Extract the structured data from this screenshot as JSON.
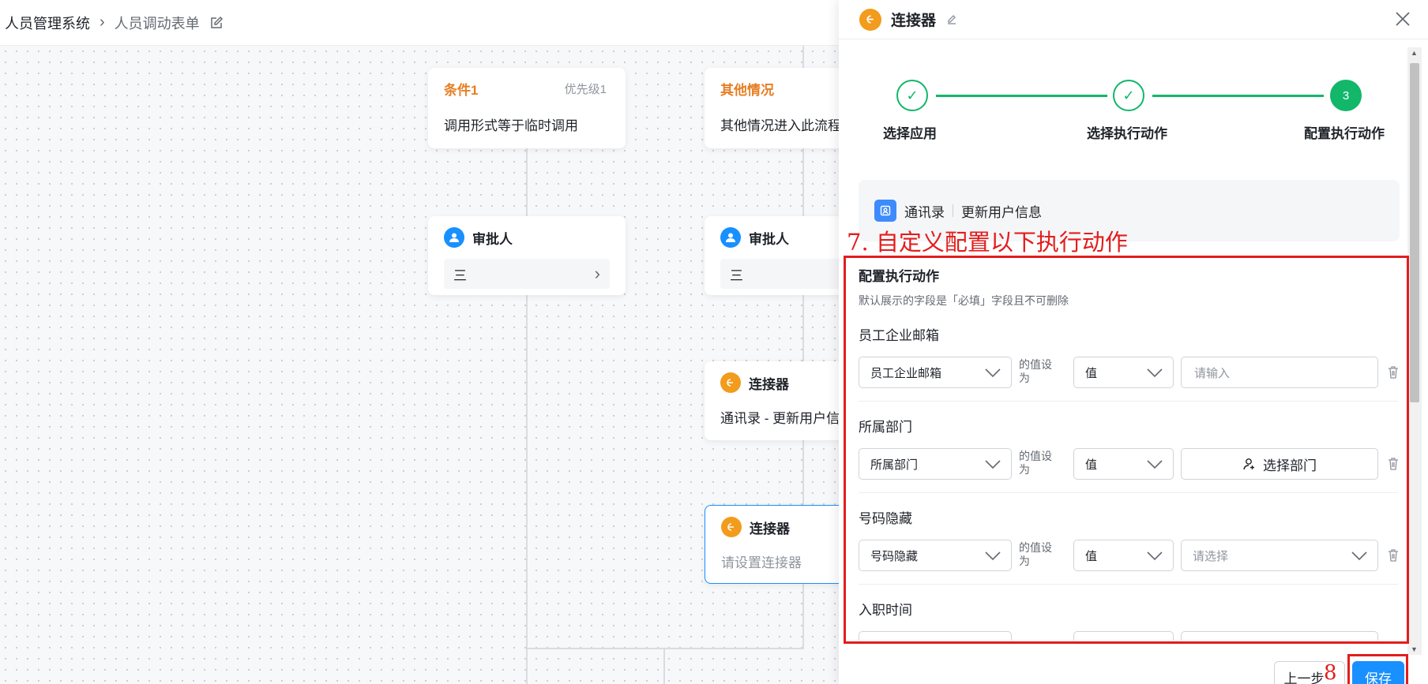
{
  "breadcrumb": {
    "app": "人员管理系统",
    "form": "人员调动表单"
  },
  "canvas": {
    "condition1": {
      "title": "条件1",
      "priority": "优先级1",
      "desc": "调用形式等于临时调用"
    },
    "condition_other": {
      "title": "其他情况",
      "desc": "其他情况进入此流程"
    },
    "approver_left": {
      "title": "审批人",
      "value": "三"
    },
    "approver_right": {
      "title": "审批人",
      "value": "三"
    },
    "connector1": {
      "title": "连接器",
      "desc": "通讯录 - 更新用户信息"
    },
    "connector2": {
      "title": "连接器",
      "placeholder": "请设置连接器"
    }
  },
  "drawer": {
    "title": "连接器",
    "steps": [
      {
        "label": "选择应用",
        "state": "done"
      },
      {
        "label": "选择执行动作",
        "state": "done"
      },
      {
        "label": "配置执行动作",
        "state": "active",
        "num": "3"
      }
    ],
    "app": {
      "name": "通讯录",
      "action": "更新用户信息"
    },
    "section_title": "配置执行动作",
    "section_hint": "默认展示的字段是「必填」字段且不可删除",
    "set_to": "的值设为",
    "value_type": "值",
    "fields": [
      {
        "label": "员工企业邮箱",
        "field": "员工企业邮箱",
        "input_placeholder": "请输入"
      },
      {
        "label": "所属部门",
        "field": "所属部门",
        "dept_button": "选择部门"
      },
      {
        "label": "号码隐藏",
        "field": "号码隐藏",
        "select_placeholder": "请选择"
      },
      {
        "label": "入职时间"
      }
    ],
    "buttons": {
      "prev": "上一步",
      "save": "保存"
    }
  },
  "annotations": {
    "step7": "7. 自定义配置以下执行动作",
    "step8": "8"
  },
  "colors": {
    "accent": "#1890ff",
    "success": "#12b76a",
    "warning": "#f29b1c",
    "annotation": "#e31d1d"
  }
}
